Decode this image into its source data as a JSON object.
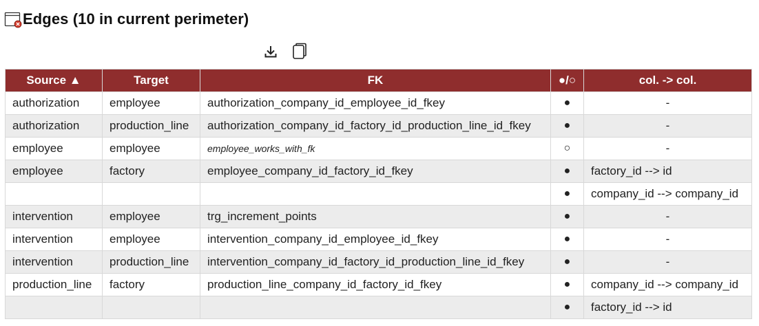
{
  "header": {
    "title": "Edges (10 in current perimeter)",
    "icon": "window-close-icon"
  },
  "toolbar": {
    "download_icon": "download-icon",
    "copy_icon": "copy-icon"
  },
  "colors": {
    "header_bg": "#8f2d2d",
    "header_text": "#ffffff",
    "row_alt": "#ececec",
    "italic_link": "#3d5a7a"
  },
  "table": {
    "columns": [
      "Source ▲",
      "Target",
      "FK",
      "●/○",
      "col. -> col."
    ],
    "rows": [
      {
        "source": "authorization",
        "target": "employee",
        "fk": "authorization_company_id_employee_id_fkey",
        "ind": "●",
        "cols": "-",
        "italic": false
      },
      {
        "source": "authorization",
        "target": "production_line",
        "fk": "authorization_company_id_factory_id_production_line_id_fkey",
        "ind": "●",
        "cols": "-",
        "italic": false
      },
      {
        "source": "employee",
        "target": "employee",
        "fk": "employee_works_with_fk",
        "ind": "○",
        "cols": "-",
        "italic": true
      },
      {
        "source": "employee",
        "target": "factory",
        "fk": "employee_company_id_factory_id_fkey",
        "ind": "●",
        "cols": "factory_id --> id",
        "italic": false
      },
      {
        "source": "",
        "target": "",
        "fk": "",
        "ind": "●",
        "cols": "company_id --> company_id",
        "italic": false
      },
      {
        "source": "intervention",
        "target": "employee",
        "fk": "trg_increment_points",
        "ind": "●",
        "cols": "-",
        "italic": false
      },
      {
        "source": "intervention",
        "target": "employee",
        "fk": "intervention_company_id_employee_id_fkey",
        "ind": "●",
        "cols": "-",
        "italic": false
      },
      {
        "source": "intervention",
        "target": "production_line",
        "fk": "intervention_company_id_factory_id_production_line_id_fkey",
        "ind": "●",
        "cols": "-",
        "italic": false
      },
      {
        "source": "production_line",
        "target": "factory",
        "fk": "production_line_company_id_factory_id_fkey",
        "ind": "●",
        "cols": "company_id --> company_id",
        "italic": false
      },
      {
        "source": "",
        "target": "",
        "fk": "",
        "ind": "●",
        "cols": "factory_id --> id",
        "italic": false
      }
    ]
  }
}
